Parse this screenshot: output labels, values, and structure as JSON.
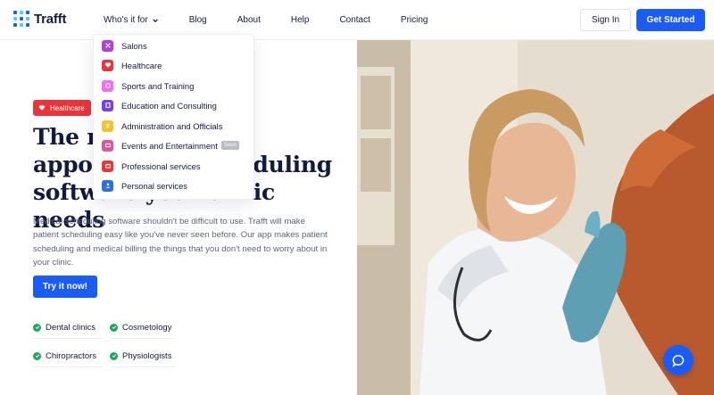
{
  "brand": {
    "name": "Trafft"
  },
  "nav": {
    "items": [
      "Who's it for",
      "Blog",
      "About",
      "Help",
      "Contact",
      "Pricing"
    ],
    "signin": "Sign In",
    "get_started": "Get Started"
  },
  "dropdown": {
    "items": [
      {
        "label": "Salons",
        "color": "#b23fd8",
        "icon": "scissors-icon"
      },
      {
        "label": "Healthcare",
        "color": "#e8353b",
        "icon": "heart-icon"
      },
      {
        "label": "Sports and Training",
        "color": "#f06ef0",
        "icon": "ball-icon"
      },
      {
        "label": "Education and Consulting",
        "color": "#7b3fe4",
        "icon": "book-icon"
      },
      {
        "label": "Administration and Officials",
        "color": "#f5c232",
        "icon": "document-icon"
      },
      {
        "label": "Events and Entertainment",
        "color": "#d9579a",
        "icon": "ticket-icon",
        "tag": "Soon"
      },
      {
        "label": "Professional services",
        "color": "#e8353b",
        "icon": "briefcase-icon"
      },
      {
        "label": "Personal services",
        "color": "#2d6ee0",
        "icon": "person-icon"
      }
    ]
  },
  "hero": {
    "badge": "Healthcare",
    "title": "The medical appointment scheduling software your clinic needs",
    "description": "Medical scheduling software shouldn't be difficult to use. Trafft will make patient scheduling easy like you've never seen before. Our app makes patient scheduling and medical billing the things that you don't need to worry about in your clinic.",
    "cta": "Try it now!",
    "features": [
      "Dental clinics",
      "Cosmetology",
      "Chiropractors",
      "Physiologists"
    ]
  },
  "colors": {
    "accent": "#1a5cf5",
    "badge": "#e8353b",
    "check": "#1ca861"
  }
}
